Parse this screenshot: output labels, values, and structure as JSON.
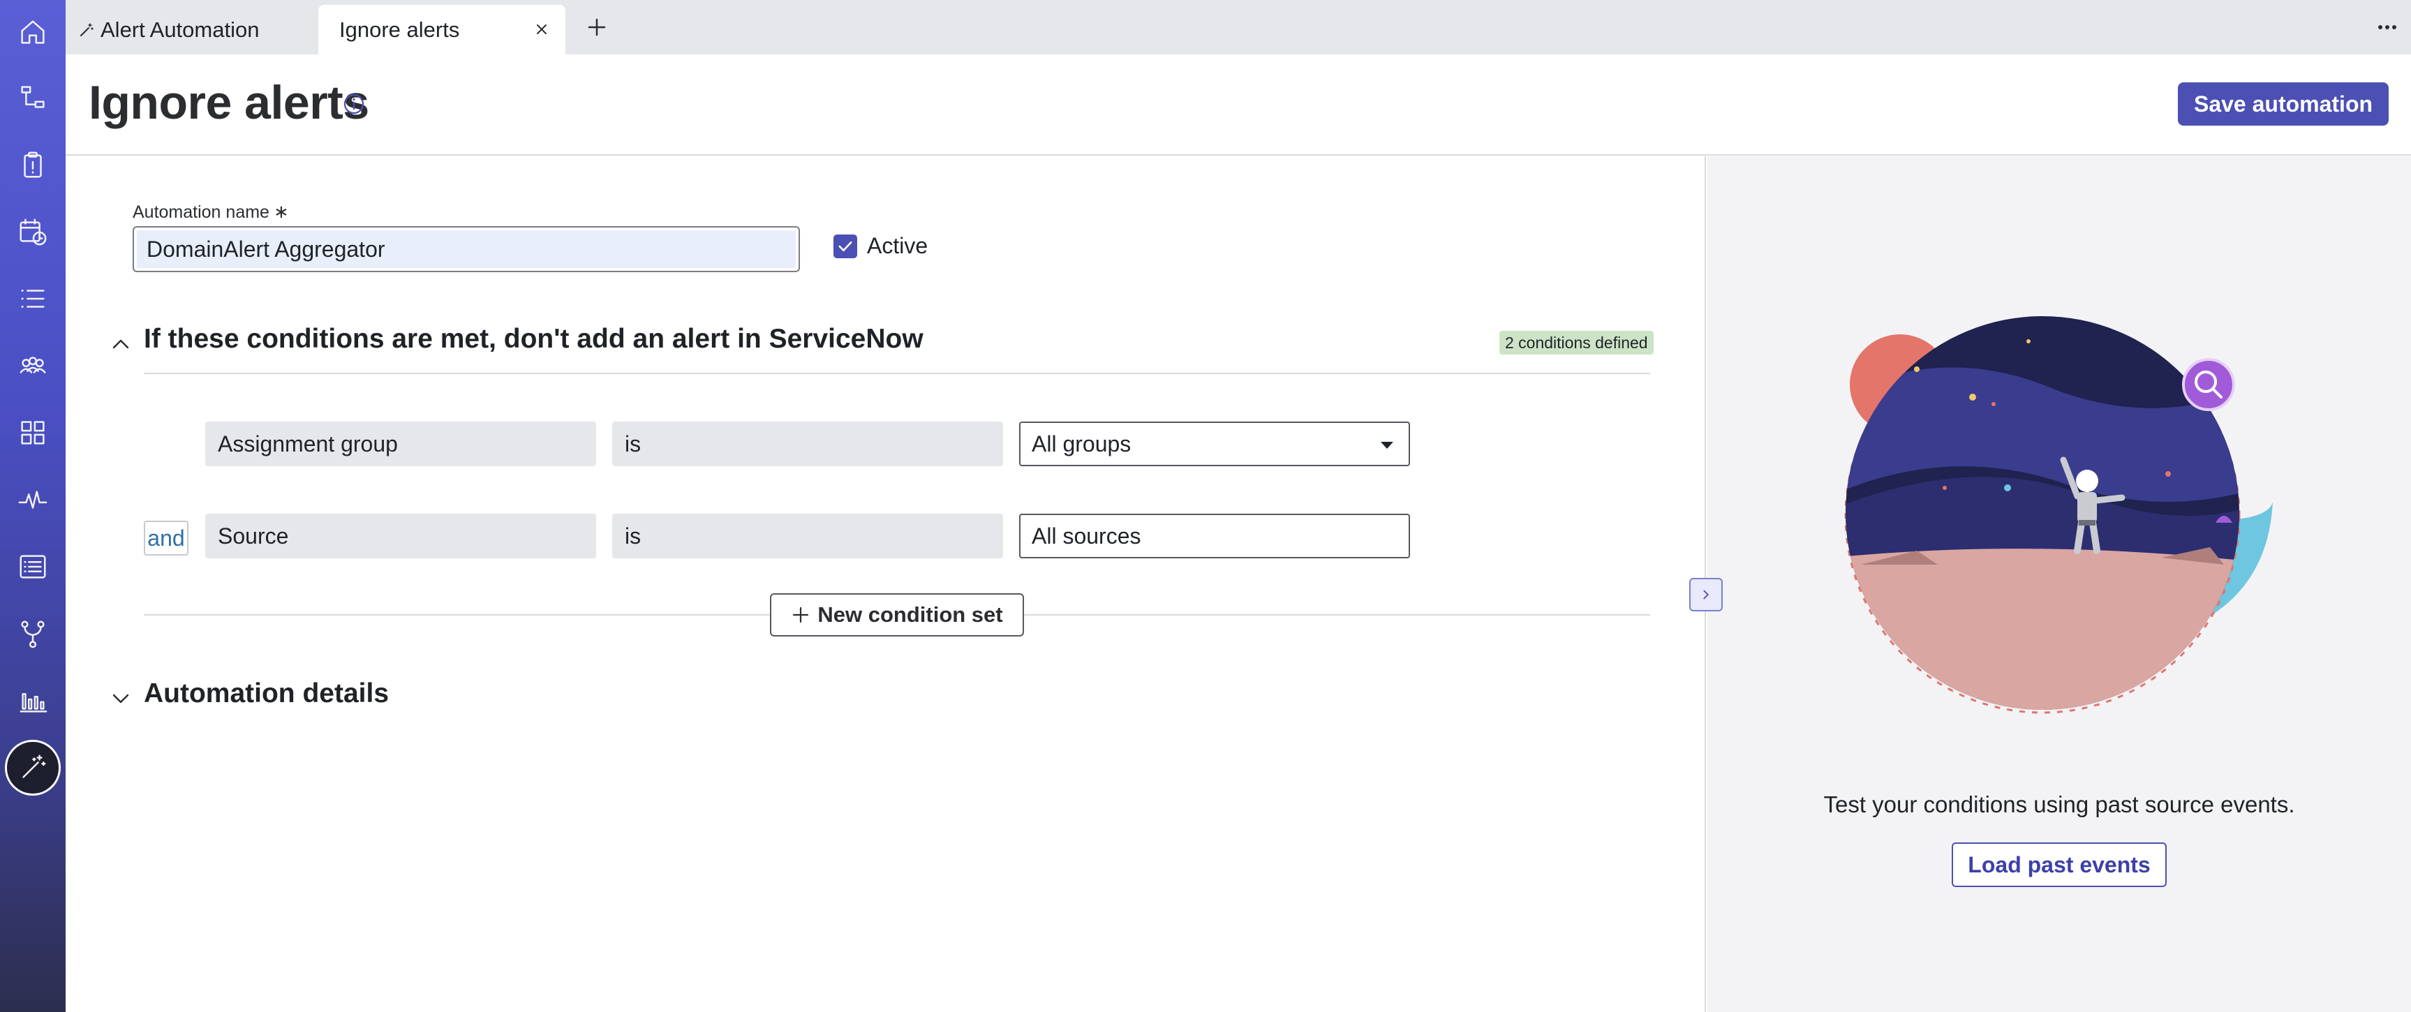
{
  "tabs": {
    "items": [
      {
        "label": "Alert Automation",
        "icon": "wand-icon"
      },
      {
        "label": "Ignore alerts",
        "active": true
      }
    ],
    "new_tab_icon": "plus-icon",
    "more_icon": "more-horizontal-icon"
  },
  "sidebar": {
    "items": [
      {
        "icon": "home-icon"
      },
      {
        "icon": "hierarchy-icon"
      },
      {
        "icon": "clipboard-alert-icon"
      },
      {
        "icon": "calendar-clock-icon"
      },
      {
        "icon": "list-icon"
      },
      {
        "icon": "teams-icon"
      },
      {
        "icon": "grid-icon"
      },
      {
        "icon": "pulse-icon"
      },
      {
        "icon": "list-box-icon"
      },
      {
        "icon": "branch-icon"
      },
      {
        "icon": "bar-chart-icon"
      },
      {
        "icon": "wand-icon",
        "active": true
      }
    ]
  },
  "header": {
    "title": "Ignore alerts",
    "save_label": "Save automation"
  },
  "form": {
    "name_label": "Automation name",
    "required_mark": "∗",
    "name_value": "DomainAlert Aggregator",
    "active_label": "Active",
    "active_checked": true
  },
  "conditions": {
    "title": "If these conditions are met, don't add an alert in ServiceNow",
    "badge": "2 conditions defined",
    "and_label": "and",
    "rows": [
      {
        "field": "Assignment group",
        "operator": "is",
        "value": "All groups"
      },
      {
        "field": "Source",
        "operator": "is",
        "value": "All sources"
      }
    ],
    "new_set_label": "New condition set"
  },
  "details": {
    "title": "Automation details"
  },
  "right_panel": {
    "text": "Test your conditions using past source events.",
    "button_label": "Load past events"
  },
  "colors": {
    "accent": "#4c4fb3",
    "badge_bg": "#cde3c6",
    "sidebar_top": "#5a5fd6",
    "sidebar_bottom": "#2c2e4e"
  }
}
